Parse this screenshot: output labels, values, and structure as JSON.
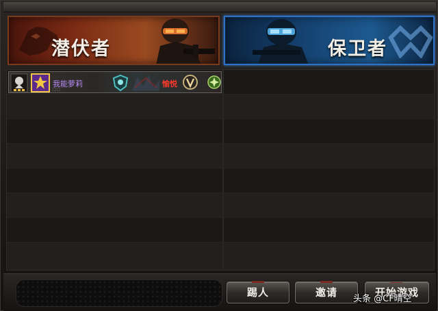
{
  "teams": {
    "infiltrator": {
      "name": "潜伏者",
      "color": "#7b2a14"
    },
    "guardian": {
      "name": "保卫者",
      "color": "#1d5a90"
    }
  },
  "player": {
    "name": "我能萝莉",
    "sub_text": "□□",
    "clan_tag": "愉悦",
    "rank_icon": "rank-badge-icon",
    "vip_icon": "vip-v-icon"
  },
  "buttons": {
    "kick": "踢人",
    "invite": "邀请",
    "start": "开始游戏"
  },
  "watermark": "头条 @CF晴空"
}
